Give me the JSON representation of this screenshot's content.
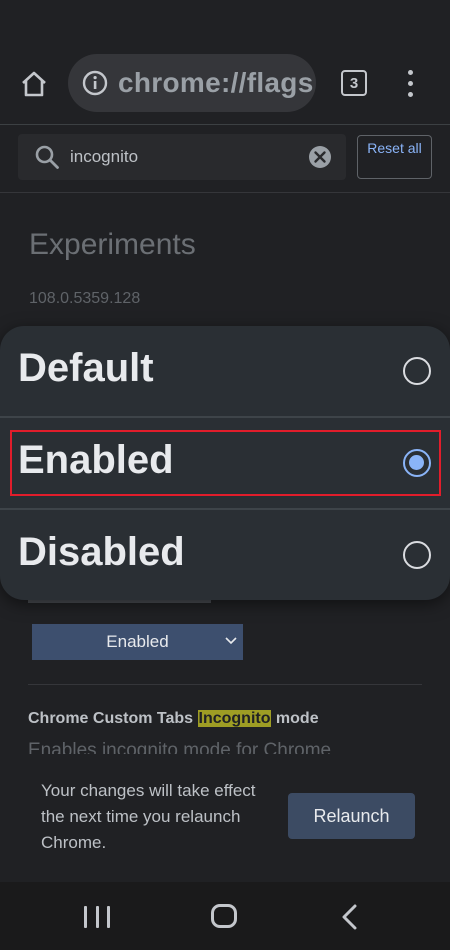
{
  "toolbar": {
    "url": "chrome://flags",
    "tab_count": "3"
  },
  "search": {
    "query": "incognito",
    "reset_label": "Reset all"
  },
  "page": {
    "title": "Experiments",
    "version": "108.0.5359.128"
  },
  "popup": {
    "options": [
      {
        "label": "Default",
        "selected": false
      },
      {
        "label": "Enabled",
        "selected": true
      },
      {
        "label": "Disabled",
        "selected": false
      }
    ]
  },
  "flag": {
    "current_value": "Enabled",
    "title_prefix": "Chrome Custom Tabs ",
    "title_highlight": "Incognito",
    "title_suffix": " mode",
    "description": "Enables incognito mode for Chrome"
  },
  "relaunch": {
    "message": "Your changes will take effect the next time you relaunch Chrome.",
    "button_label": "Relaunch"
  },
  "colors": {
    "accent": "#8ab4f8",
    "highlight_border": "#e11d2b",
    "search_highlight": "#9e9d24"
  }
}
